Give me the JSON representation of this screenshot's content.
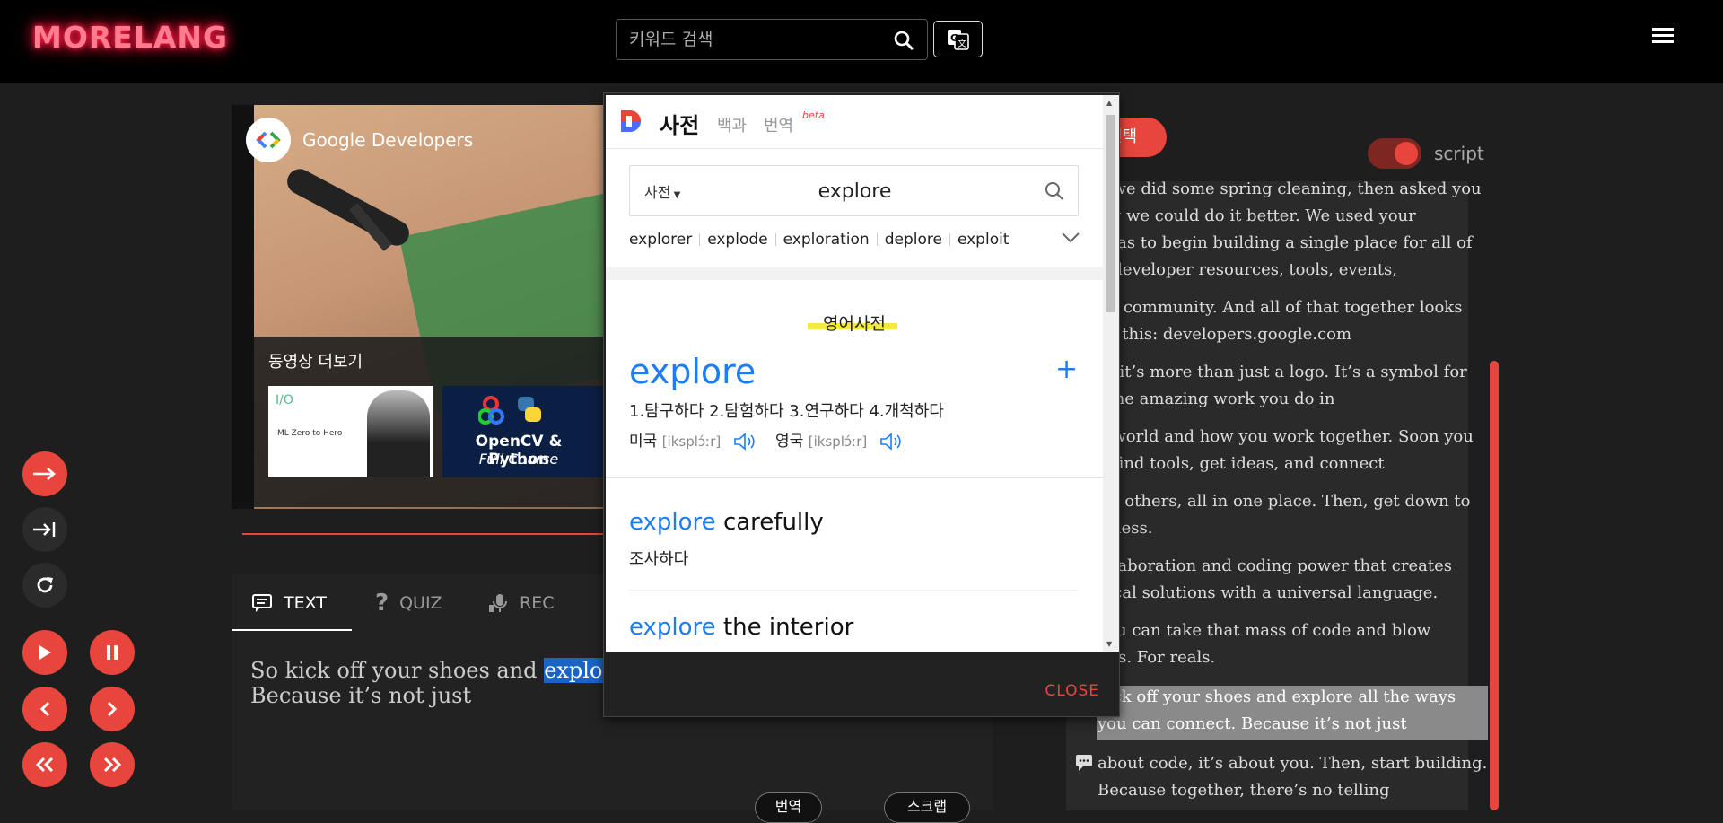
{
  "header": {
    "logo": "MORELANG",
    "search_placeholder": "키워드 검색"
  },
  "video": {
    "channel": "Google Developers",
    "more_videos": "동영상 더보기",
    "thumb1_top": "I/O",
    "thumb1_caption": "ML Zero to Hero",
    "thumb2_title": "OpenCV & Python",
    "thumb2_subtitle": "Full Course"
  },
  "tabs": [
    {
      "label": "TEXT",
      "active": true
    },
    {
      "label": "QUIZ",
      "active": false
    },
    {
      "label": "REC",
      "active": false
    }
  ],
  "script_text": {
    "line1_before": "So kick off your shoes and ",
    "line1_highlight": "explore",
    "line2": "Because it’s not just"
  },
  "bottom_buttons": {
    "translate": "번역",
    "scrap": "스크랩"
  },
  "right_panel": {
    "select_label": "선택",
    "toggle_label": "script",
    "lines": [
      "o we did some spring cleaning, then asked you",
      "ow we could do it better. We used your",
      "deas to begin building a single place for all of",
      "e developer resources, tools, events,",
      "nd community. And all of that together looks",
      "ke this: developers.google.com",
      "ut it’s more than just a logo. It’s a symbol for",
      "l the amazing work you do in",
      "e world and how you work together. Soon you",
      "n find tools, get ideas, and connect",
      "ith others, all in one place. Then, get down to",
      "siness.",
      "ollaboration and coding power that creates",
      "gical solutions with a universal language.",
      " you can take that mass of code and blow",
      "nds. For reals.",
      " kick off your shoes and explore all the ways",
      "you can connect. Because it’s not just",
      "about code, it’s about you. Then, start building.",
      "Because together, there’s no telling"
    ]
  },
  "dictionary": {
    "tab_dict": "사전",
    "tab_encyclopedia": "백과",
    "tab_translate": "번역",
    "beta": "beta",
    "category": "사전",
    "query": "explore",
    "suggestions": [
      "explorer",
      "explode",
      "exploration",
      "deplore",
      "exploit"
    ],
    "section": "영어사전",
    "word": "explore",
    "meanings": "1.탐구하다   2.탐험하다   3.연구하다   4.개척하다",
    "pron_us_label": "미국",
    "pron_us": "[iksplɔ́ːr]",
    "pron_uk_label": "영국",
    "pron_uk": "[iksplɔ́ːr]",
    "examples": [
      {
        "bold": "explore",
        "rest": " carefully",
        "meaning": "조사하다"
      },
      {
        "bold": "explore",
        "rest": " the interior",
        "meaning": ""
      }
    ],
    "close": "CLOSE"
  },
  "colors": {
    "accent_red": "#e8453c",
    "link_blue": "#1e7cf5",
    "highlight_yellow": "#f4ea3c"
  }
}
